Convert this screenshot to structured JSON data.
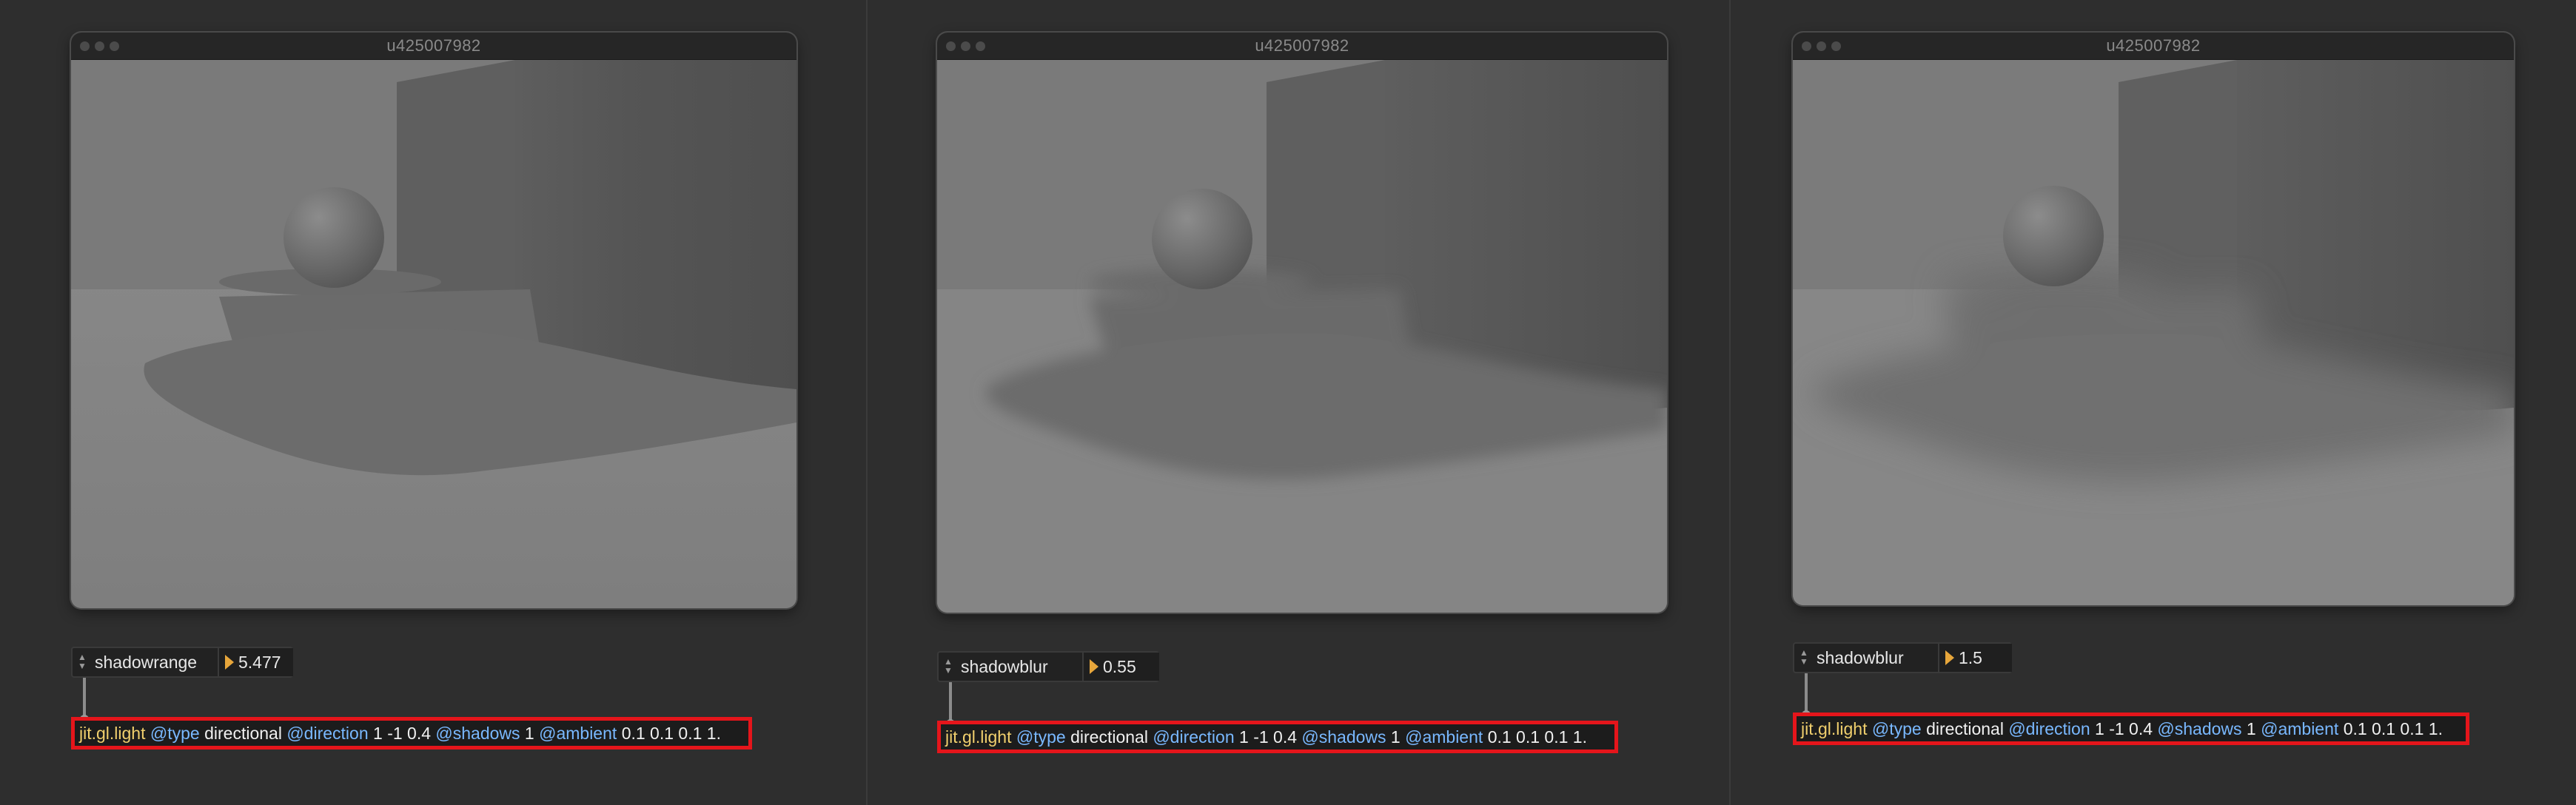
{
  "panels": [
    {
      "window_title": "u425007982",
      "attr_label": "shadowrange",
      "attr_value": "5.477",
      "object": {
        "name": "jit.gl.light",
        "tokens": [
          {
            "kind": "attr",
            "text": "@type"
          },
          {
            "kind": "val",
            "text": "directional"
          },
          {
            "kind": "attr",
            "text": "@direction"
          },
          {
            "kind": "val",
            "text": "1 -1 0.4"
          },
          {
            "kind": "attr",
            "text": "@shadows"
          },
          {
            "kind": "val",
            "text": "1"
          },
          {
            "kind": "attr",
            "text": "@ambient"
          },
          {
            "kind": "val",
            "text": "0.1 0.1 0.1 1."
          }
        ]
      }
    },
    {
      "window_title": "u425007982",
      "attr_label": "shadowblur",
      "attr_value": "0.55",
      "object": {
        "name": "jit.gl.light",
        "tokens": [
          {
            "kind": "attr",
            "text": "@type"
          },
          {
            "kind": "val",
            "text": "directional"
          },
          {
            "kind": "attr",
            "text": "@direction"
          },
          {
            "kind": "val",
            "text": "1 -1 0.4"
          },
          {
            "kind": "attr",
            "text": "@shadows"
          },
          {
            "kind": "val",
            "text": "1"
          },
          {
            "kind": "attr",
            "text": "@ambient"
          },
          {
            "kind": "val",
            "text": "0.1 0.1 0.1 1."
          }
        ]
      }
    },
    {
      "window_title": "u425007982",
      "attr_label": "shadowblur",
      "attr_value": "1.5",
      "object": {
        "name": "jit.gl.light",
        "tokens": [
          {
            "kind": "attr",
            "text": "@type"
          },
          {
            "kind": "val",
            "text": "directional"
          },
          {
            "kind": "attr",
            "text": "@direction"
          },
          {
            "kind": "val",
            "text": "1 -1 0.4"
          },
          {
            "kind": "attr",
            "text": "@shadows"
          },
          {
            "kind": "val",
            "text": "1"
          },
          {
            "kind": "attr",
            "text": "@ambient"
          },
          {
            "kind": "val",
            "text": "0.1 0.1 0.1 1."
          }
        ]
      }
    }
  ],
  "colors": {
    "background": "#2e2e2e",
    "highlight": "#e5151b",
    "object_name": "#f0cf6d",
    "attribute": "#79b8ff",
    "number_triangle": "#e7a63b"
  },
  "icons": {
    "arrows": "up-down-arrows-icon",
    "triangle": "number-triangle-icon"
  }
}
